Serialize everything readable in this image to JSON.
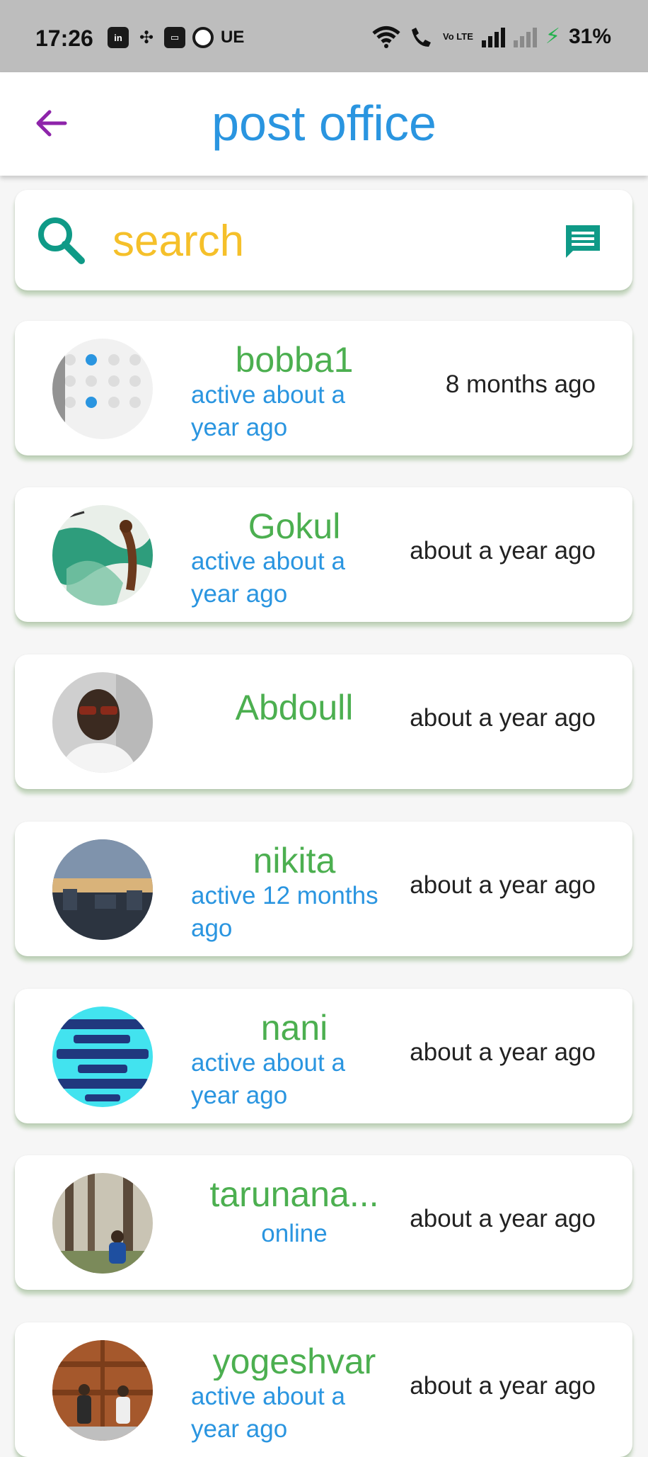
{
  "status_bar": {
    "time": "17:26",
    "left_icons": [
      "linkedin-icon",
      "pinwheel-icon",
      "paytm-icon",
      "circle-app-icon"
    ],
    "carrier_text": "UE",
    "network_label": "Vo LTE",
    "battery": "31%"
  },
  "app_bar": {
    "title": "post office",
    "back_icon": "arrow-left-icon",
    "back_color": "#8e24aa",
    "title_color": "#2a95e0"
  },
  "search": {
    "placeholder": "search",
    "icon": "search-icon",
    "action_icon": "chat-icon",
    "icon_color": "#0f9a87",
    "text_color": "#f5c02a"
  },
  "contacts": [
    {
      "name": "bobba1",
      "status": "active about a year ago",
      "time": "8 months ago",
      "avatar": "settings-screenshot-avatar"
    },
    {
      "name": "Gokul",
      "status": "active about a year ago",
      "time": "about a year ago",
      "avatar": "painting-avatar"
    },
    {
      "name": "Abdoull",
      "status": "",
      "time": "about a year ago",
      "avatar": "person-sunglasses-avatar"
    },
    {
      "name": "nikita",
      "status": "active 12 months ago",
      "time": "about a year ago",
      "avatar": "city-sunset-avatar"
    },
    {
      "name": "nani",
      "status": "active about a year ago",
      "time": "about a year ago",
      "avatar": "telugu-text-avatar"
    },
    {
      "name": "tarunana...",
      "status": "online",
      "time": "about a year ago",
      "avatar": "forest-person-avatar"
    },
    {
      "name": "yogeshvar",
      "status": "active about a year ago",
      "time": "about a year ago",
      "avatar": "two-people-door-avatar"
    }
  ]
}
